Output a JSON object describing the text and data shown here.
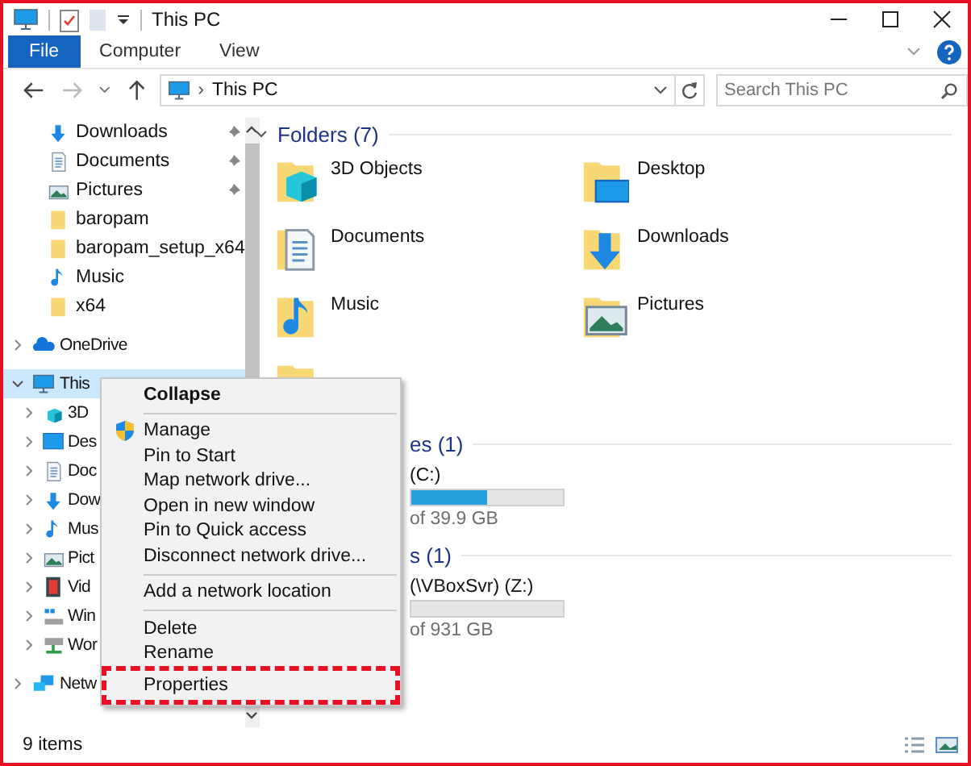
{
  "window": {
    "title": "This PC"
  },
  "ribbon_tabs": [
    {
      "label": "File",
      "selected": true
    },
    {
      "label": "Computer",
      "selected": false
    },
    {
      "label": "View",
      "selected": false
    }
  ],
  "address": {
    "separator": "›",
    "path": "This PC"
  },
  "search": {
    "placeholder": "Search This PC"
  },
  "sidebar": {
    "quick_access_items": [
      {
        "label": "Downloads",
        "kind": "download",
        "pinned": true
      },
      {
        "label": "Documents",
        "kind": "documents",
        "pinned": true
      },
      {
        "label": "Pictures",
        "kind": "pictures",
        "pinned": true
      },
      {
        "label": "baropam",
        "kind": "folder",
        "pinned": false
      },
      {
        "label": "baropam_setup_x64",
        "kind": "folder",
        "pinned": false
      },
      {
        "label": "Music",
        "kind": "music",
        "pinned": false
      },
      {
        "label": "x64",
        "kind": "folder",
        "pinned": false
      }
    ],
    "items": [
      {
        "label": "OneDrive",
        "kind": "onedrive",
        "expanded": false,
        "selected": false
      },
      {
        "label": "This",
        "kind": "pc",
        "expanded": true,
        "selected": true,
        "children": [
          {
            "label": "3D",
            "kind": "objects3d",
            "expanded": false
          },
          {
            "label": "Des",
            "kind": "desktop",
            "expanded": false
          },
          {
            "label": "Doc",
            "kind": "documents",
            "expanded": false
          },
          {
            "label": "Dow",
            "kind": "download",
            "expanded": false
          },
          {
            "label": "Mus",
            "kind": "music",
            "expanded": false
          },
          {
            "label": "Pict",
            "kind": "pictures",
            "expanded": false
          },
          {
            "label": "Vid",
            "kind": "videos",
            "expanded": false
          },
          {
            "label": "Win",
            "kind": "windisk",
            "expanded": false
          },
          {
            "label": "Wor",
            "kind": "netdrive",
            "expanded": false
          }
        ]
      },
      {
        "label": "Netw",
        "kind": "network",
        "expanded": false,
        "selected": false
      }
    ]
  },
  "folders_section": {
    "title": "Folders (7)",
    "expanded": true,
    "folders": [
      {
        "name": "3D Objects",
        "kind": "objects3d"
      },
      {
        "name": "Desktop",
        "kind": "desktop"
      },
      {
        "name": "Documents",
        "kind": "documents"
      },
      {
        "name": "Downloads",
        "kind": "download"
      },
      {
        "name": "Music",
        "kind": "music"
      },
      {
        "name": "Pictures",
        "kind": "pictures"
      },
      {
        "kind": "videos"
      }
    ]
  },
  "drive_sections": [
    {
      "title": "es (1)",
      "drives": [
        {
          "name": "(C:)",
          "level": 0.5,
          "reading": "of 39.9 GB"
        }
      ]
    },
    {
      "title": "s (1)",
      "drives": [
        {
          "name": "(\\VBoxSvr) (Z:)",
          "level": 0,
          "reading": "of 931 GB"
        }
      ]
    }
  ],
  "context_menu": [
    {
      "kind": "item",
      "label": "Collapse",
      "bold": true,
      "shield": false,
      "highlighted": false
    },
    {
      "kind": "separator"
    },
    {
      "kind": "item",
      "label": "Manage",
      "bold": false,
      "shield": true,
      "highlighted": false
    },
    {
      "kind": "item",
      "label": "Pin to Start",
      "bold": false,
      "shield": false,
      "highlighted": false
    },
    {
      "kind": "item",
      "label": "Map network drive...",
      "bold": false,
      "shield": false,
      "highlighted": false
    },
    {
      "kind": "item",
      "label": "Open in new window",
      "bold": false,
      "shield": false,
      "highlighted": false
    },
    {
      "kind": "item",
      "label": "Pin to Quick access",
      "bold": false,
      "shield": false,
      "highlighted": false
    },
    {
      "kind": "item",
      "label": "Disconnect network drive...",
      "bold": false,
      "shield": false,
      "highlighted": false
    },
    {
      "kind": "separator"
    },
    {
      "kind": "item",
      "label": "Add a network location",
      "bold": false,
      "shield": false,
      "highlighted": false
    },
    {
      "kind": "separator"
    },
    {
      "kind": "item",
      "label": "Delete",
      "bold": false,
      "shield": false,
      "highlighted": false
    },
    {
      "kind": "item",
      "label": "Rename",
      "bold": false,
      "shield": false,
      "highlighted": false
    },
    {
      "kind": "item",
      "label": "Properties",
      "bold": false,
      "shield": false,
      "highlighted": true
    }
  ],
  "status_bar": {
    "item_count": "9 items"
  }
}
